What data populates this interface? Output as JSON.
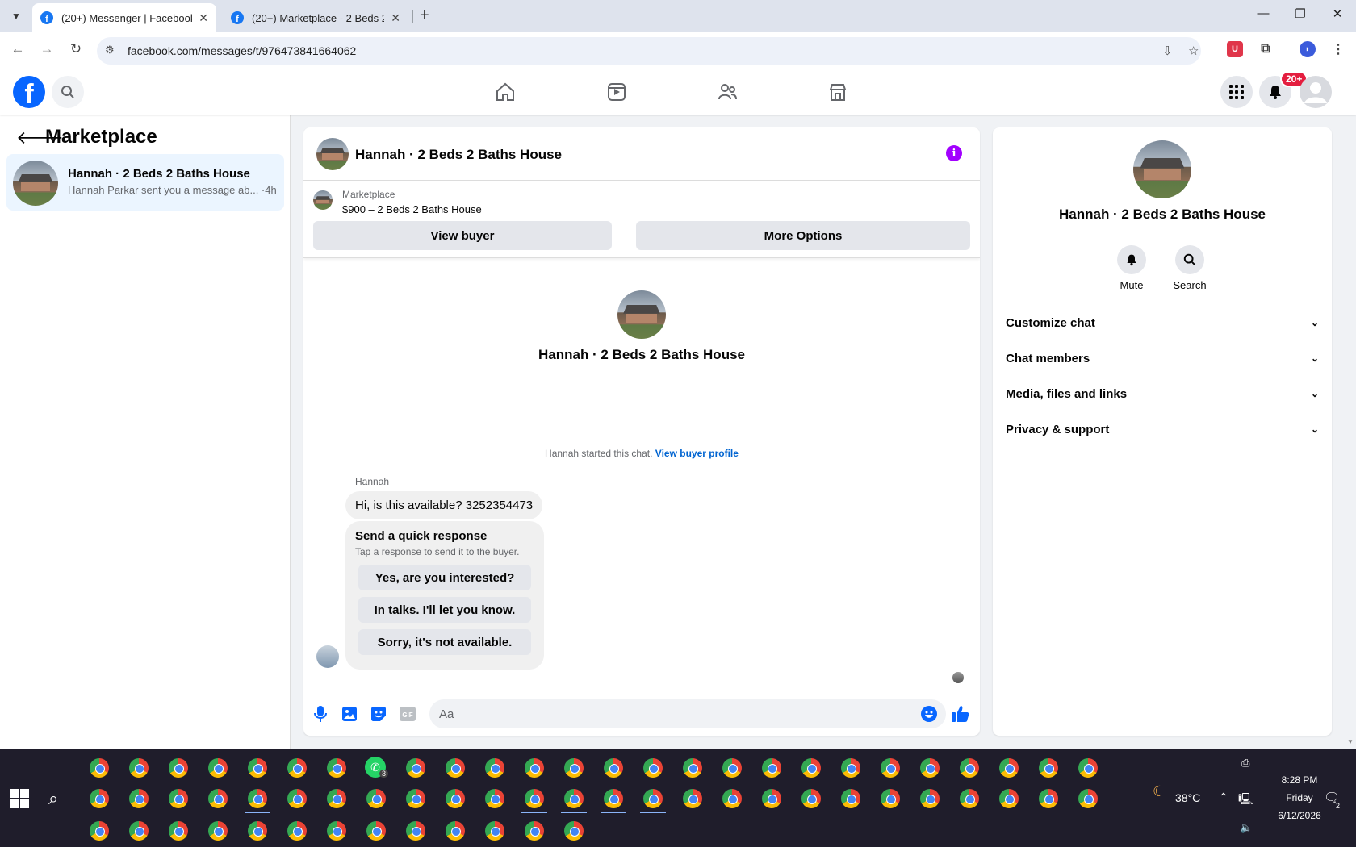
{
  "browser": {
    "tabs": [
      {
        "title": "(20+) Messenger | Facebook",
        "active": true
      },
      {
        "title": "(20+) Marketplace - 2 Beds 2 B",
        "active": false
      }
    ],
    "url": "facebook.com/messages/t/976473841664062"
  },
  "header": {
    "notification_count": "20+"
  },
  "sidebar": {
    "title": "Marketplace",
    "conversations": [
      {
        "name": "Hannah · 2 Beds 2 Baths House",
        "preview": "Hannah Parkar sent you a message ab... ·4h"
      }
    ]
  },
  "chat": {
    "title": "Hannah · 2 Beds 2 Baths House",
    "listing": {
      "label": "Marketplace",
      "price_title": "$900 – 2 Beds 2 Baths House",
      "view_buyer": "View buyer",
      "more_options": "More Options"
    },
    "intro_name": "Hannah · 2 Beds 2 Baths House",
    "started_text": "Hannah started this chat.",
    "view_buyer_profile": "View buyer profile",
    "sender": "Hannah",
    "message": "Hi, is this available? 3252354473",
    "quick_response": {
      "title": "Send a quick response",
      "subtitle": "Tap a response to send it to the buyer.",
      "options": [
        "Yes, are you interested?",
        "In talks. I'll let you know.",
        "Sorry, it's not available."
      ]
    },
    "composer_placeholder": "Aa"
  },
  "info_panel": {
    "name": "Hannah · 2 Beds 2 Baths House",
    "actions": [
      "Mute",
      "Search"
    ],
    "sections": [
      "Customize chat",
      "Chat members",
      "Media, files and links",
      "Privacy & support"
    ]
  },
  "taskbar": {
    "temperature": "38°C",
    "time": "8:28 PM",
    "day": "Friday",
    "date": "6/12/2026",
    "whatsapp_badge": "3",
    "notification_badge": "2"
  },
  "colors": {
    "facebook_blue": "#0866ff",
    "messenger_purple": "#a200ff",
    "badge_red": "#e41e3f",
    "selected_convo": "#ebf5ff"
  }
}
